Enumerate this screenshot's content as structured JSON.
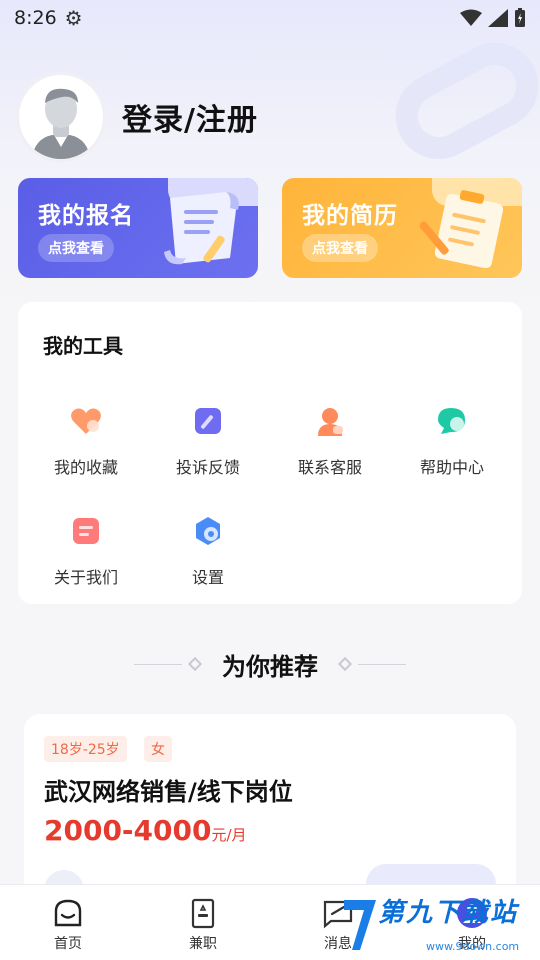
{
  "status_bar": {
    "time": "8:26"
  },
  "profile": {
    "login_label": "登录/注册"
  },
  "cards": [
    {
      "title": "我的报名",
      "action": "点我查看"
    },
    {
      "title": "我的简历",
      "action": "点我查看"
    }
  ],
  "tools": {
    "title": "我的工具",
    "items": [
      {
        "label": "我的收藏",
        "icon": "heart-icon",
        "color": "#ff9a6a"
      },
      {
        "label": "投诉反馈",
        "icon": "edit-icon",
        "color": "#6f6cf2"
      },
      {
        "label": "联系客服",
        "icon": "customer-service-icon",
        "color": "#ff8a5c"
      },
      {
        "label": "帮助中心",
        "icon": "chat-icon",
        "color": "#1fc9a6"
      },
      {
        "label": "关于我们",
        "icon": "info-card-icon",
        "color": "#ff7a7a"
      },
      {
        "label": "设置",
        "icon": "settings-icon",
        "color": "#4a8cf7"
      }
    ]
  },
  "recommend": {
    "title": "为你推荐"
  },
  "job": {
    "tags": [
      "18岁-25岁",
      "女"
    ],
    "title": "武汉网络销售/线下岗位",
    "salary": "2000-4000",
    "salary_unit": "元/月"
  },
  "tabbar": {
    "items": [
      {
        "label": "首页",
        "icon": "home-icon"
      },
      {
        "label": "兼职",
        "icon": "job-icon"
      },
      {
        "label": "消息",
        "icon": "message-icon"
      },
      {
        "label": "我的",
        "icon": "user-icon"
      }
    ]
  },
  "watermark": {
    "text": "第九下载站",
    "url": "www.9down.com"
  },
  "colors": {
    "accent": "#5a5ee6",
    "orange": "#ffb43a",
    "salary": "#e63a2e"
  }
}
